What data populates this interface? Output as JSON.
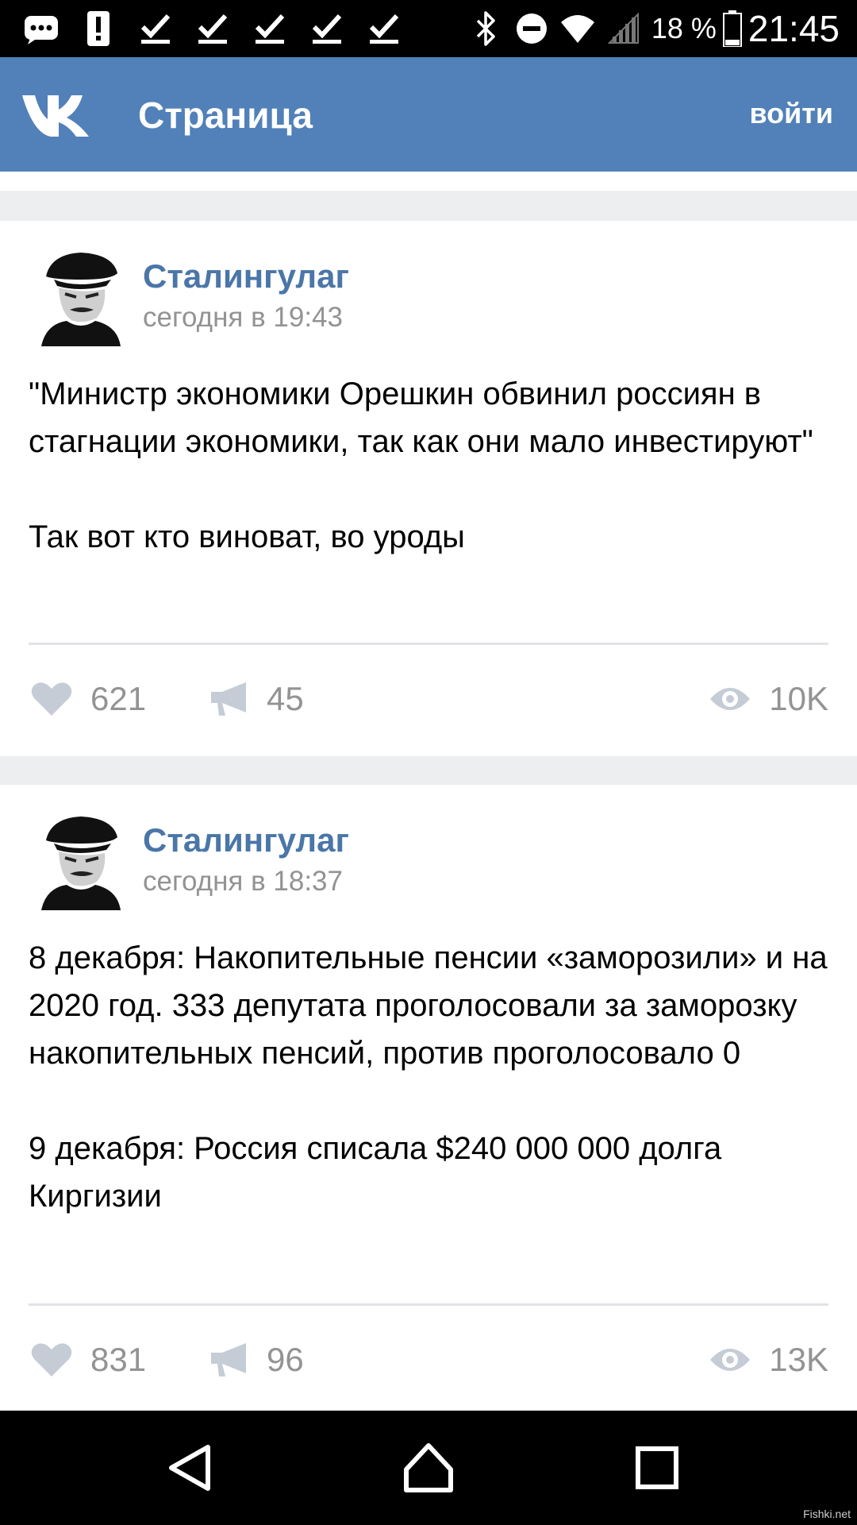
{
  "status_bar": {
    "notification_icons": [
      "chat-bubble-icon",
      "alert-icon",
      "download-done-icon",
      "download-done-icon",
      "download-done-icon",
      "download-done-icon",
      "download-done-icon"
    ],
    "system_icons": [
      "bluetooth-icon",
      "do-not-disturb-icon",
      "wifi-icon",
      "signal-icon"
    ],
    "battery_pct": "18 %",
    "battery_level": 0.18,
    "time": "21:45"
  },
  "header": {
    "logo": "vk-logo",
    "title": "Страница",
    "login_label": "войти",
    "color": "#5181b8"
  },
  "posts": [
    {
      "author": "Сталингулаг",
      "time": "сегодня в 19:43",
      "paragraphs": [
        "\"Министр экономики Орешкин обвинил россиян в стагнации экономики, так как они мало инвестируют\"",
        "Так вот кто виноват, во уроды"
      ],
      "likes": "621",
      "reposts": "45",
      "views": "10K"
    },
    {
      "author": "Сталингулаг",
      "time": "сегодня в 18:37",
      "paragraphs": [
        "8 декабря: Накопительные пенсии «заморозили» и на 2020 год. 333 депутата проголосовали за заморозку накопительных пенсий, против проголосовало 0",
        "9 декабря: Россия списала $240 000 000 долга Киргизии"
      ],
      "likes": "831",
      "reposts": "96",
      "views": "13K"
    }
  ],
  "nav": {
    "icons": [
      "back-icon",
      "home-icon",
      "recents-icon"
    ]
  },
  "watermark": "Fishki.net"
}
